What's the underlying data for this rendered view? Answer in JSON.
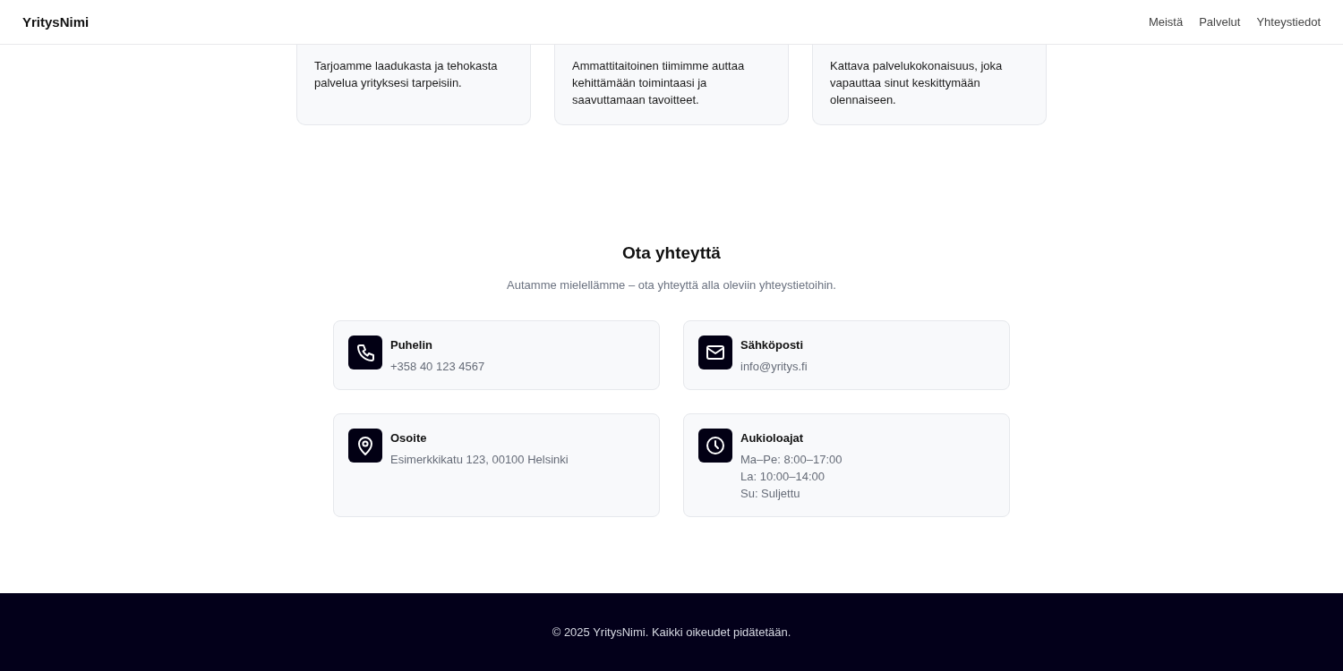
{
  "header": {
    "brand": "YritysNimi",
    "nav": [
      {
        "label": "Meistä"
      },
      {
        "label": "Palvelut"
      },
      {
        "label": "Yhteystiedot"
      }
    ]
  },
  "services": [
    {
      "description": "Tarjoamme laadukasta ja tehokasta palvelua yrityksesi tarpeisiin."
    },
    {
      "description": "Ammattitaitoinen tiimimme auttaa kehittämään toimintaasi ja saavuttamaan tavoitteet."
    },
    {
      "description": "Kattava palvelukokonaisuus, joka vapauttaa sinut keskittymään olennaiseen."
    }
  ],
  "contact": {
    "title": "Ota yhteyttä",
    "subtitle": "Autamme mielellämme – ota yhteyttä alla oleviin yhteystietoihin.",
    "items": [
      {
        "kind": "phone",
        "label": "Puhelin",
        "lines": [
          "+358 40 123 4567"
        ]
      },
      {
        "kind": "email",
        "label": "Sähköposti",
        "lines": [
          "info@yritys.fi"
        ]
      },
      {
        "kind": "location",
        "label": "Osoite",
        "lines": [
          "Esimerkkikatu 123, 00100 Helsinki"
        ]
      },
      {
        "kind": "clock",
        "label": "Aukioloajat",
        "lines": [
          "Ma–Pe: 8:00–17:00",
          "La: 10:00–14:00",
          "Su: Suljettu"
        ]
      }
    ]
  },
  "footer": {
    "text": "© 2025 YritysNimi. Kaikki oikeudet pidätetään."
  }
}
